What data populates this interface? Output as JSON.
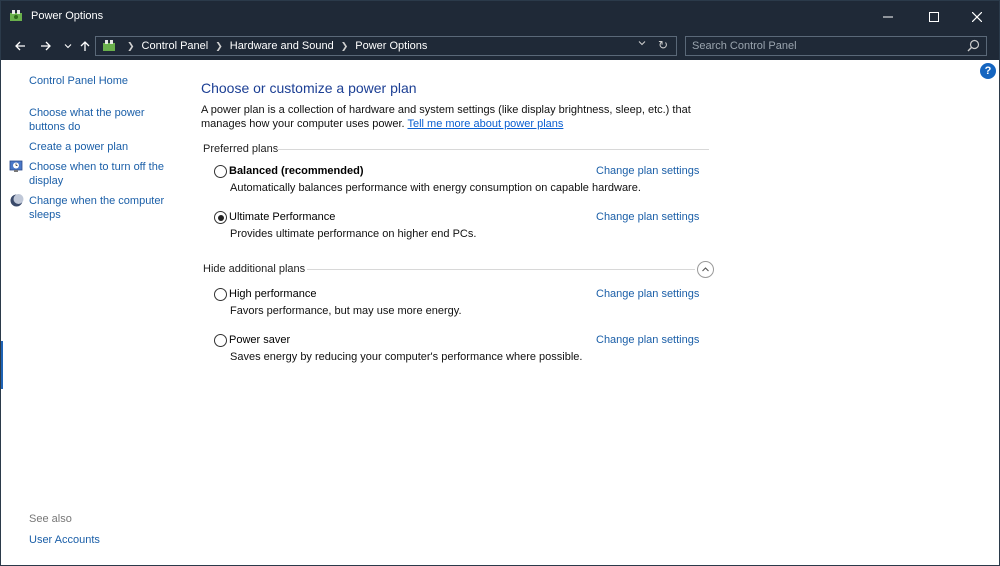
{
  "window": {
    "title": "Power Options"
  },
  "address": {
    "crumbs": [
      "Control Panel",
      "Hardware and Sound",
      "Power Options"
    ],
    "search_placeholder": "Search Control Panel"
  },
  "sidebar": {
    "home": "Control Panel Home",
    "items": [
      {
        "label_line1": "Choose what the power",
        "label_line2": "buttons do"
      },
      {
        "label_line1": "Create a power plan",
        "label_line2": ""
      },
      {
        "label_line1": "Choose when to turn off the",
        "label_line2": "display"
      },
      {
        "label_line1": "Change when the computer",
        "label_line2": "sleeps"
      }
    ],
    "see_also": "See also",
    "see_also_items": [
      "User Accounts"
    ]
  },
  "main": {
    "title": "Choose or customize a power plan",
    "description": "A power plan is a collection of hardware and system settings (like display brightness, sleep, etc.) that manages how your computer uses power.",
    "description_link": "Tell me more about power plans",
    "preferred_header": "Preferred plans",
    "additional_header": "Hide additional plans",
    "change_label": "Change plan settings",
    "preferred_plans": [
      {
        "name": "Balanced (recommended)",
        "desc": "Automatically balances performance with energy consumption on capable hardware.",
        "selected": false
      },
      {
        "name": "Ultimate Performance",
        "desc": "Provides ultimate performance on higher end PCs.",
        "selected": true
      }
    ],
    "additional_plans": [
      {
        "name": "High performance",
        "desc": "Favors performance, but may use more energy.",
        "selected": false
      },
      {
        "name": "Power saver",
        "desc": "Saves energy by reducing your computer's performance where possible.",
        "selected": false
      }
    ]
  },
  "help_label": "?"
}
